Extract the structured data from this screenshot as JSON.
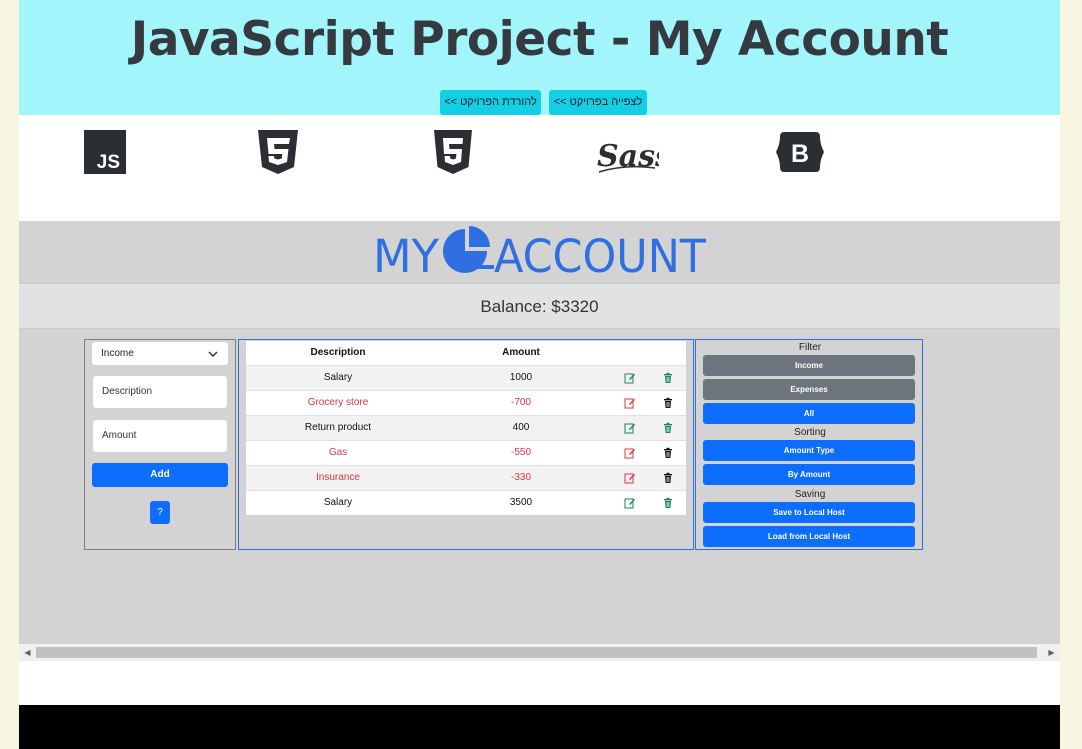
{
  "header": {
    "title": "JavaScript Project - My Account",
    "download_button": "להורדת הפרויקט >>",
    "view_button": "לצפייה בפרויקט >>"
  },
  "tech_logos": [
    "javascript-icon",
    "css3-icon",
    "html5-icon",
    "sass-icon",
    "bootstrap-icon"
  ],
  "sass_logo_text": "Sass",
  "app": {
    "brand_left": "MY",
    "brand_right": "ACCOUNT",
    "balance": "Balance: $3320",
    "form": {
      "type_selected": "Income",
      "description_placeholder": "Description",
      "amount_placeholder": "Amount",
      "add_label": "Add",
      "help_label": "?"
    },
    "table": {
      "headers": [
        "Description",
        "Amount"
      ],
      "rows": [
        {
          "description": "Salary",
          "amount": "1000",
          "type": "income"
        },
        {
          "description": "Grocery store",
          "amount": "-700",
          "type": "expense"
        },
        {
          "description": "Return product",
          "amount": "400",
          "type": "income"
        },
        {
          "description": "Gas",
          "amount": "-550",
          "type": "expense"
        },
        {
          "description": "Insurance",
          "amount": "-330",
          "type": "expense"
        },
        {
          "description": "Salary",
          "amount": "3500",
          "type": "income"
        }
      ]
    },
    "controls": {
      "filter_label": "Filter",
      "filter_income": "Income",
      "filter_expenses": "Expenses",
      "filter_all": "All",
      "sorting_label": "Sorting",
      "sort_amount_type": "Amount Type",
      "sort_by_amount": "By Amount",
      "saving_label": "Saving",
      "save_local": "Save to Local Host",
      "load_local": "Load from Local Host"
    }
  },
  "colors": {
    "header_bg": "#a2f5fa",
    "header_button": "#12cfe6",
    "primary": "#0d6efd",
    "secondary": "#6c757d",
    "expense_text": "#dc3545",
    "income_icon": "#198754",
    "brand_blue": "#2f6fe0"
  }
}
